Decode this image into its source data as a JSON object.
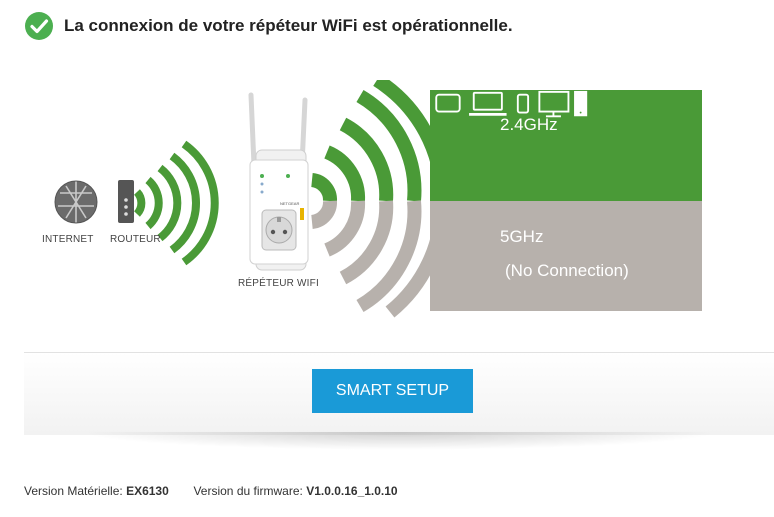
{
  "status": {
    "message": "La connexion de votre répéteur WiFi est opérationnelle.",
    "icon": "check-circle-icon",
    "color": "#4caf50"
  },
  "diagram": {
    "internet_label": "INTERNET",
    "router_label": "ROUTEUR",
    "repeater_label": "RÉPÉTEUR WIFI",
    "repeater_brand": "NETGEAR",
    "band_24": {
      "label": "2.4GHz",
      "color": "#4a9a37"
    },
    "band_5": {
      "label": "5GHz",
      "status": "(No Connection)",
      "color": "#b7b1ac"
    },
    "devices": [
      "tablet-icon",
      "laptop-icon",
      "phone-icon",
      "monitor-icon",
      "tower-icon"
    ]
  },
  "setup": {
    "button_label": "SMART SETUP",
    "color": "#1a9ad7"
  },
  "footer": {
    "hw_label": "Version Matérielle:",
    "hw_value": "EX6130",
    "fw_label": "Version du firmware:",
    "fw_value": "V1.0.0.16_1.0.10"
  }
}
